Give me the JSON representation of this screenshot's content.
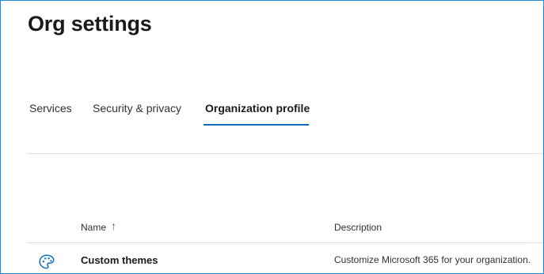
{
  "header": {
    "title": "Org settings"
  },
  "tabs": [
    {
      "label": "Services",
      "active": false
    },
    {
      "label": "Security & privacy",
      "active": false
    },
    {
      "label": "Organization profile",
      "active": true
    }
  ],
  "table": {
    "columns": {
      "name": "Name",
      "description": "Description"
    },
    "sort": {
      "column": "Name",
      "direction": "ascending",
      "arrow": "↑"
    },
    "rows": [
      {
        "icon": "palette-icon",
        "name": "Custom themes",
        "description": "Customize Microsoft 365 for your organization."
      }
    ]
  },
  "colors": {
    "accent": "#0f6cbd",
    "frame_border": "#1f8ad6",
    "divider": "#e1dfdd"
  }
}
